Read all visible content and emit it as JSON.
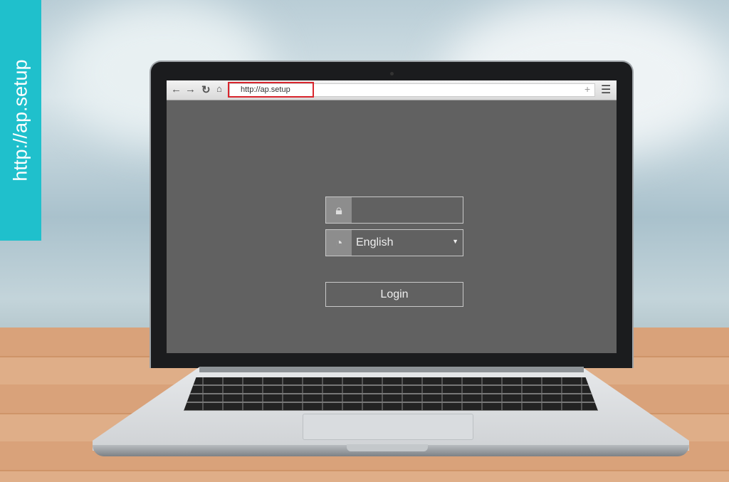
{
  "banner": {
    "text": "http://ap.setup",
    "color": "#1fc0cc"
  },
  "browser": {
    "url": "http://ap.setup",
    "icons": [
      "back-arrow-icon",
      "forward-arrow-icon",
      "reload-icon",
      "home-icon",
      "plus-icon",
      "hamburger-menu-icon"
    ],
    "highlight_color": "#d9262e"
  },
  "login_form": {
    "password_value": "",
    "language": "English",
    "login_label": "Login"
  }
}
